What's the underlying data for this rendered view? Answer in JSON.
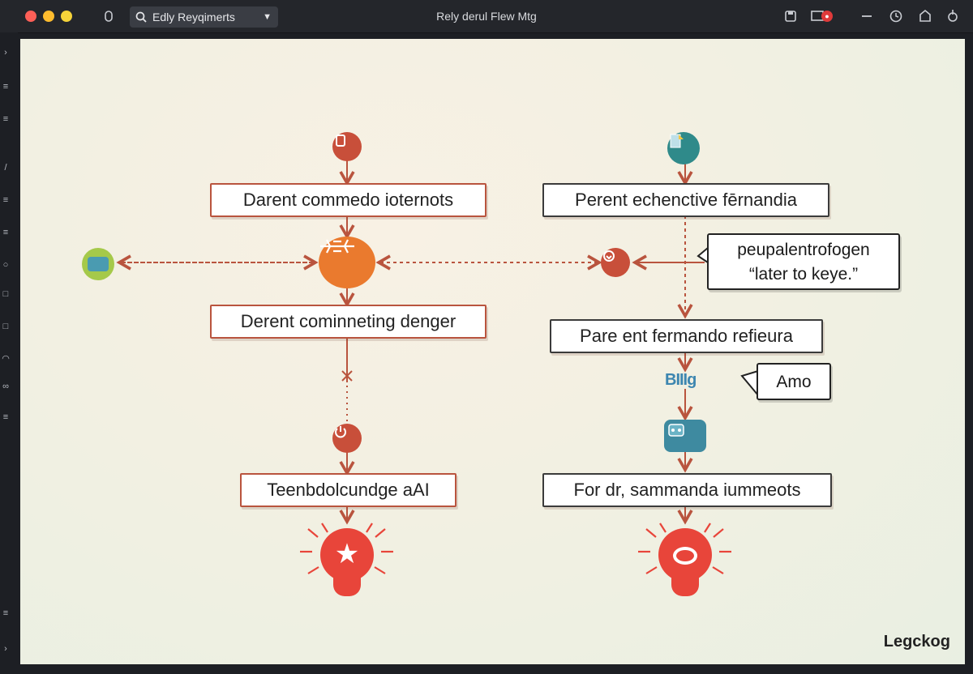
{
  "window": {
    "title": "Rely derul Flew Mtg",
    "search_value": "Edly Reyqimerts"
  },
  "toolbar_icons": [
    "save-icon",
    "comment-icon",
    "minus-icon",
    "clock-icon",
    "home-icon",
    "share-icon"
  ],
  "notification_badge": "●",
  "diagram": {
    "left": {
      "box1": "Darent commedo ioternots",
      "box2": "Derent cominneting denger",
      "box3": "Teenbdolcundge aAI"
    },
    "right": {
      "box1": "Perent echenctive fērnandia",
      "box2": "Pare ent fermando refieura",
      "box3": "For dr, sammanda iummeots"
    },
    "callout_main_line1": "peupalentrofogen",
    "callout_main_line2": "“later to keye.”",
    "callout_small": "Amo",
    "mini_label": "BIIIg"
  },
  "watermark": "Legckog",
  "colors": {
    "accent_red": "#b9543e",
    "accent_orange": "#ea7a2e",
    "bulb_red": "#e8453a",
    "icon_green": "#a5c94a"
  }
}
